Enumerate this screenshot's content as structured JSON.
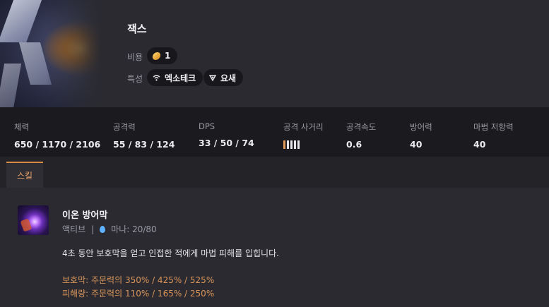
{
  "champion": {
    "name": "잭스",
    "cost_label": "비용",
    "cost_value": "1",
    "traits_label": "특성",
    "traits": [
      {
        "name": "엑소테크",
        "icon": "wifi-icon"
      },
      {
        "name": "요새",
        "icon": "shield-triangle-icon"
      }
    ]
  },
  "stats": [
    {
      "label": "체력",
      "value": "650 / 1170 / 2106"
    },
    {
      "label": "공격력",
      "value": "55 / 83 / 124"
    },
    {
      "label": "DPS",
      "value": "33 / 50 / 74"
    },
    {
      "label": "공격 사거리",
      "range_level": 1,
      "range_max": 5
    },
    {
      "label": "공격속도",
      "value": "0.6"
    },
    {
      "label": "방어력",
      "value": "40"
    },
    {
      "label": "마법 저항력",
      "value": "40"
    }
  ],
  "tabs": [
    {
      "label": "스킬",
      "active": true
    }
  ],
  "skill": {
    "name": "이온 방어막",
    "type": "액티브",
    "separator": "|",
    "mana": "마나: 20/80",
    "description": "4초 동안 보호막을 얻고 인접한 적에게 마법 피해를 입힙니다.",
    "scalings": [
      "보호막: 주문력의 350% / 425% / 525%",
      "피해량: 주문력의 110% / 165% / 250%"
    ]
  },
  "colors": {
    "accent": "#d98b46",
    "scaling_text": "#d9955a",
    "mana": "#5fb2ff"
  }
}
